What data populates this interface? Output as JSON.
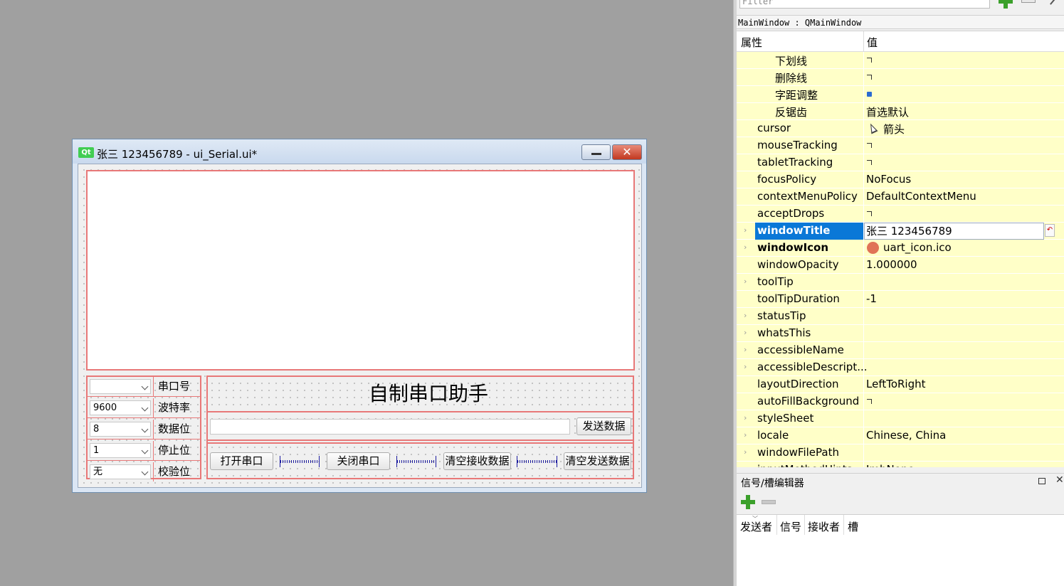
{
  "designer_window": {
    "logo": "Qt",
    "title": "张三 123456789 - ui_Serial.ui*",
    "close_glyph": "✕",
    "port_rows": [
      {
        "value": "",
        "label": "串口号"
      },
      {
        "value": "9600",
        "label": "波特率"
      },
      {
        "value": "8",
        "label": "数据位"
      },
      {
        "value": "1",
        "label": "停止位"
      },
      {
        "value": "无",
        "label": "校验位"
      }
    ],
    "heading": "自制串口助手",
    "send_button": "发送数据",
    "open_button": "打开串口",
    "close_button": "关闭串口",
    "clear_recv_button": "清空接收数据",
    "clear_send_button": "清空发送数据"
  },
  "property_editor": {
    "filter_placeholder": "Filter",
    "object_label": "MainWindow : QMainWindow",
    "header_name": "属性",
    "header_value": "值",
    "rows": [
      {
        "name": "下划线",
        "type": "checkbox",
        "checked": false,
        "sub": true
      },
      {
        "name": "删除线",
        "type": "checkbox",
        "checked": false,
        "sub": true
      },
      {
        "name": "字距调整",
        "type": "checkbox",
        "checked": true,
        "sub": true
      },
      {
        "name": "反锯齿",
        "value": "首选默认",
        "sub": true
      },
      {
        "name": "cursor",
        "value": "箭头",
        "icon": "arrow-cursor-icon"
      },
      {
        "name": "mouseTracking",
        "type": "checkbox",
        "checked": false
      },
      {
        "name": "tabletTracking",
        "type": "checkbox",
        "checked": false
      },
      {
        "name": "focusPolicy",
        "value": "NoFocus"
      },
      {
        "name": "contextMenuPolicy",
        "value": "DefaultContextMenu"
      },
      {
        "name": "acceptDrops",
        "type": "checkbox",
        "checked": false
      },
      {
        "name": "windowTitle",
        "value": "张三 123456789",
        "expandable": true,
        "modified": true,
        "selected": true
      },
      {
        "name": "windowIcon",
        "value": "uart_icon.ico",
        "expandable": true,
        "modified": true,
        "icon": "uart-icon"
      },
      {
        "name": "windowOpacity",
        "value": "1.000000"
      },
      {
        "name": "toolTip",
        "value": "",
        "expandable": true
      },
      {
        "name": "toolTipDuration",
        "value": "-1"
      },
      {
        "name": "statusTip",
        "value": "",
        "expandable": true
      },
      {
        "name": "whatsThis",
        "value": "",
        "expandable": true
      },
      {
        "name": "accessibleName",
        "value": "",
        "expandable": true
      },
      {
        "name": "accessibleDescript...",
        "value": "",
        "expandable": true
      },
      {
        "name": "layoutDirection",
        "value": "LeftToRight"
      },
      {
        "name": "autoFillBackground",
        "type": "checkbox",
        "checked": false
      },
      {
        "name": "styleSheet",
        "value": "",
        "expandable": true
      },
      {
        "name": "locale",
        "value": "Chinese, China",
        "expandable": true
      },
      {
        "name": "windowFilePath",
        "value": "",
        "expandable": true
      },
      {
        "name": "inputMethodHints",
        "value": "ImhNone",
        "expandable": true
      }
    ]
  },
  "signal_slot_editor": {
    "title": "信号/槽编辑器",
    "close_glyph": "✕",
    "columns": [
      "发送者",
      "信号",
      "接收者",
      "槽"
    ]
  },
  "colors": {
    "canvas": "#a0a0a0",
    "layout_outline": "#e87878",
    "property_row": "#ffffc8",
    "selection": "#0a78d7"
  }
}
